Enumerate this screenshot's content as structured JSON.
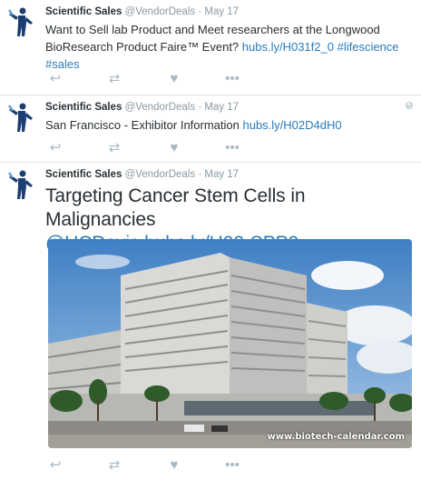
{
  "tweets": [
    {
      "author_name": "Scientific Sales",
      "handle": "@VendorDeals",
      "sep": "·",
      "date": "May 17",
      "text": "Want to Sell lab Product and Meet researchers at  the Longwood BioResearch Product Faire™ Event? ",
      "link": "hubs.ly/H031f2_0",
      "hashtag1": "#lifescience",
      "hashtag2": "#sales"
    },
    {
      "author_name": "Scientific Sales",
      "handle": "@VendorDeals",
      "sep": "·",
      "date": "May 17",
      "text": "San Francisco - Exhibitor Information ",
      "link": "hubs.ly/H02D4dH0"
    },
    {
      "author_name": "Scientific Sales",
      "handle": "@VendorDeals",
      "sep": "·",
      "date": "May 17",
      "text": "Targeting Cancer Stem Cells in Malignancies",
      "mention": "@UCDavis",
      "link": "hubs.ly/H02-SPP0",
      "image_watermark": "www.biotech-calendar.com"
    }
  ],
  "actions": {
    "reply": "↩",
    "retweet": "⇄",
    "like": "♥",
    "more": "•••"
  },
  "colors": {
    "text": "#292f33",
    "meta": "#8899a6",
    "link": "#2b7bb9",
    "action": "#aab8c2",
    "divider": "#e1e8ed"
  },
  "icons": {
    "avatar": "scientist-logo-icon",
    "reply": "reply-icon",
    "retweet": "retweet-icon",
    "like": "heart-icon",
    "more": "more-dots-icon",
    "globe": "globe-icon"
  }
}
